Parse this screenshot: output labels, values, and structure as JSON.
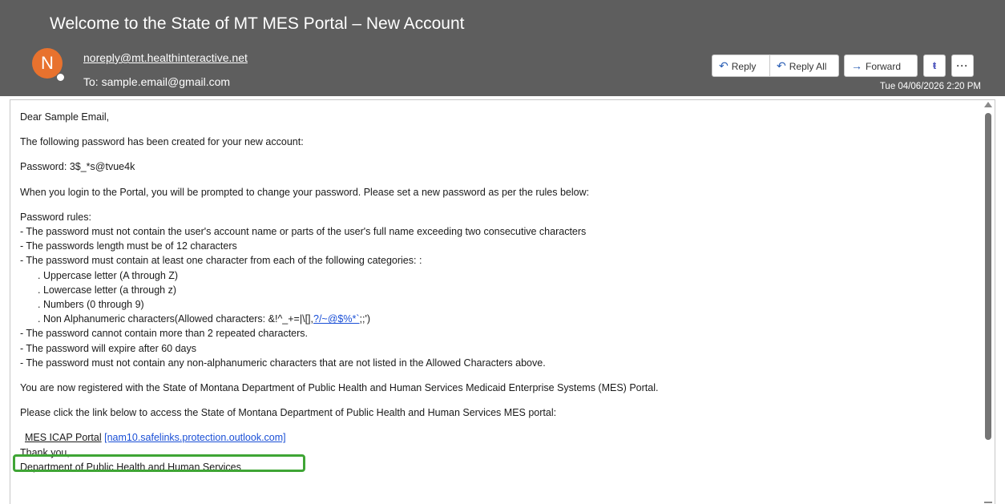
{
  "email": {
    "subject": "Welcome to the State of MT MES Portal – New Account",
    "avatar_initial": "N",
    "sender": "noreply@mt.healthinteractive.net",
    "recipient": "To: sample.email@gmail.com",
    "date": "Tue 04/06/2026 2:20 PM"
  },
  "actions": {
    "reply": "Reply",
    "reply_all": "Reply All",
    "forward": "Forward",
    "teams": "ŧ",
    "more": "···"
  },
  "icons": {
    "reply": "reply-icon",
    "reply_all": "reply-all-icon",
    "forward": "forward-icon",
    "teams": "teams-icon",
    "more": "more-options-icon"
  },
  "body": {
    "greeting": "Dear Sample Email,",
    "intro": "The following password has been created for your new account:",
    "password_line": "Password: 3$_*s@tvue4k",
    "login_note": "When you login to the Portal, you will be prompted to change your password. Please set a new password as per the rules below:",
    "rules_title": "Password rules:",
    "rule_1": "- The password must not contain the user's account name or parts of the user's full name exceeding two consecutive characters",
    "rule_2": "- The passwords length must be of 12 characters",
    "rule_3": "- The password must contain at least one character from each of the following categories: :",
    "cat_upper": ". Uppercase letter (A through Z)",
    "cat_lower": ". Lowercase letter (a through z)",
    "cat_numbers": ". Numbers (0 through 9)",
    "cat_nonalpha_prefix": ". Non Alphanumeric characters(Allowed characters: &!^_+=|\\[],",
    "cat_nonalpha_link": "?/~@$%*`",
    "cat_nonalpha_suffix": ";;')",
    "rule_4": "- The password cannot contain more than 2 repeated characters.",
    "rule_5": "- The password will expire after 60 days",
    "rule_6": "- The password must not contain any non-alphanumeric characters that are not listed in the Allowed Characters above.",
    "registered": "You are now registered with the State of Montana Department of Public Health and Human Services Medicaid Enterprise Systems (MES) Portal.",
    "click_note": "Please click the link below to access the State of Montana Department of Public Health and Human Services MES portal:",
    "portal_label": "MES ICAP Portal",
    "portal_link": "[nam10.safelinks.protection.outlook.com]",
    "thanks": "Thank you,",
    "signature": "Department of Public Health and Human Services"
  },
  "colors": {
    "header_bg": "#5e5e5e",
    "avatar_bg": "#e8722e",
    "link": "#1a4fd6",
    "highlight_box": "#3fa535"
  }
}
